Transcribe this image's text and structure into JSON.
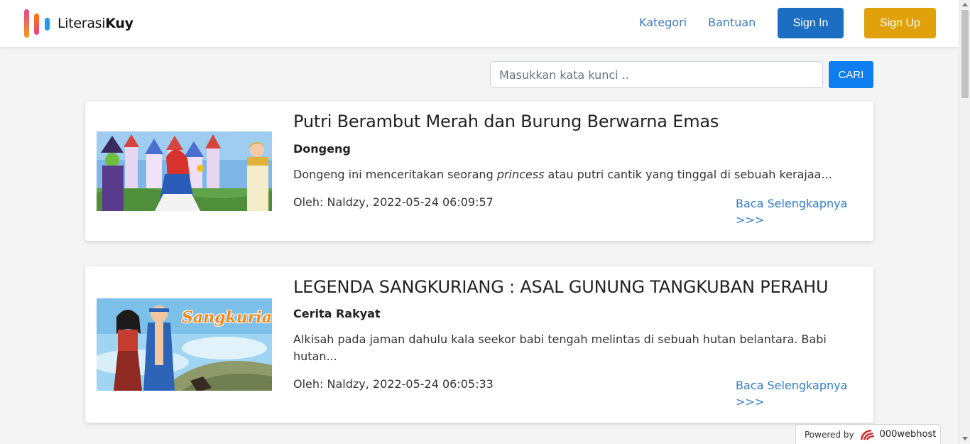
{
  "brand": {
    "name_light": "Literasi",
    "name_bold": "Kuy"
  },
  "nav": {
    "kategori": "Kategori",
    "bantuan": "Bantuan",
    "sign_in": "Sign In",
    "sign_up": "Sign Up"
  },
  "search": {
    "placeholder": "Masukkan kata kunci ..",
    "value": "",
    "button": "CARI"
  },
  "articles": [
    {
      "title": "Putri Berambut Merah dan Burung Berwarna Emas",
      "category": "Dongeng",
      "excerpt_before": "Dongeng ini menceritakan seorang ",
      "excerpt_italic": "princess",
      "excerpt_after": " atau putri cantik yang tinggal di sebuah kerajaa...",
      "meta": "Oleh: Naldzy, 2022-05-24 06:09:57",
      "read_more": "Baca Selengkapnya >>>"
    },
    {
      "title": "LEGENDA SANGKURIANG : ASAL GUNUNG TANGKUBAN PERAHU",
      "category": "Cerita Rakyat",
      "excerpt": "Alkisah pada jaman dahulu kala seekor babi tengah melintas di sebuah hutan belantara. Babi hutan...",
      "image_text": "Sangkuriang",
      "meta": "Oleh: Naldzy, 2022-05-24 06:05:33",
      "read_more": "Baca Selengkapnya >>>"
    }
  ],
  "footer_badge": {
    "label": "Powered by",
    "brand": "000webhost"
  },
  "colors": {
    "primary": "#1b6ec2",
    "accent": "#dfa00a",
    "search_button": "#0d7df0",
    "link": "#2f7cc8"
  }
}
